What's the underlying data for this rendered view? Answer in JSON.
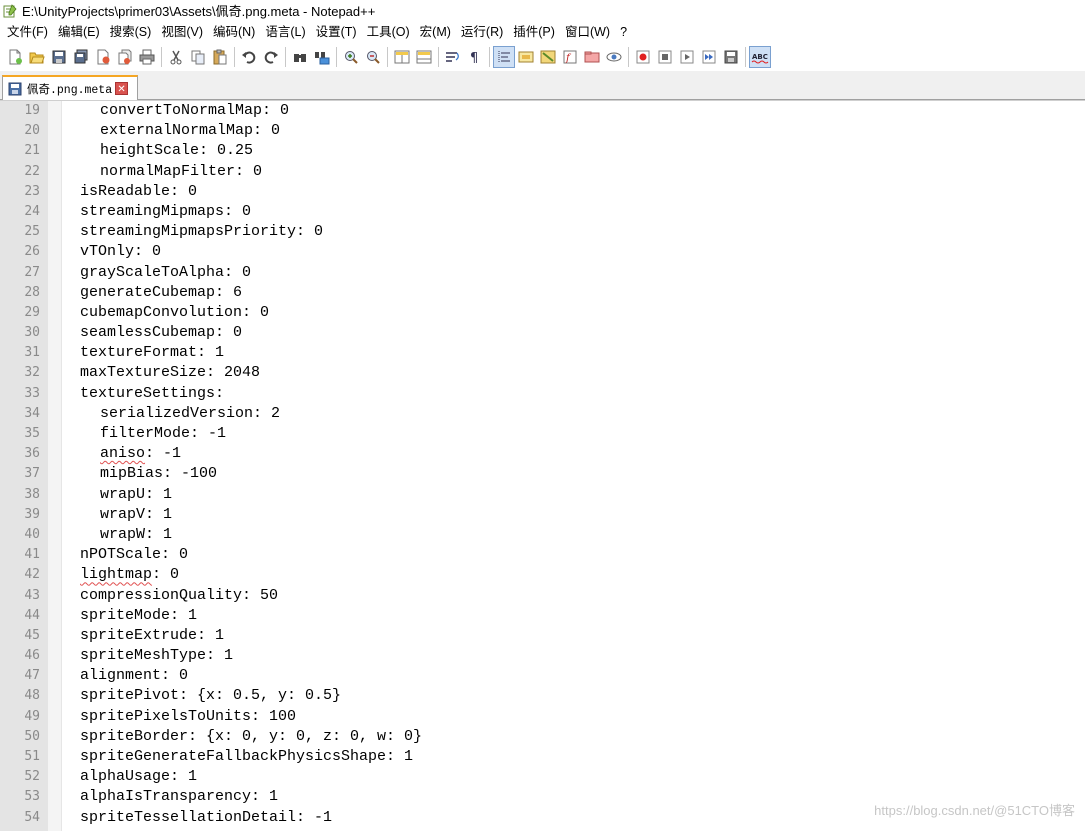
{
  "window": {
    "title": "E:\\UnityProjects\\primer03\\Assets\\佩奇.png.meta - Notepad++"
  },
  "menu": [
    "文件(F)",
    "编辑(E)",
    "搜索(S)",
    "视图(V)",
    "编码(N)",
    "语言(L)",
    "设置(T)",
    "工具(O)",
    "宏(M)",
    "运行(R)",
    "插件(P)",
    "窗口(W)",
    "?"
  ],
  "tab": {
    "label": "佩奇.png.meta",
    "close_glyph": "✕"
  },
  "editor": {
    "lines": [
      {
        "n": "19",
        "indent": 2,
        "text": "convertToNormalMap: 0"
      },
      {
        "n": "20",
        "indent": 2,
        "text": "externalNormalMap: 0"
      },
      {
        "n": "21",
        "indent": 2,
        "text": "heightScale: 0.25"
      },
      {
        "n": "22",
        "indent": 2,
        "text": "normalMapFilter: 0"
      },
      {
        "n": "23",
        "indent": 1,
        "text": "isReadable: 0"
      },
      {
        "n": "24",
        "indent": 1,
        "text": "streamingMipmaps: 0"
      },
      {
        "n": "25",
        "indent": 1,
        "text": "streamingMipmapsPriority: 0"
      },
      {
        "n": "26",
        "indent": 1,
        "text": "vTOnly: 0"
      },
      {
        "n": "27",
        "indent": 1,
        "text": "grayScaleToAlpha: 0"
      },
      {
        "n": "28",
        "indent": 1,
        "text": "generateCubemap: 6"
      },
      {
        "n": "29",
        "indent": 1,
        "text": "cubemapConvolution: 0"
      },
      {
        "n": "30",
        "indent": 1,
        "text": "seamlessCubemap: 0"
      },
      {
        "n": "31",
        "indent": 1,
        "text": "textureFormat: 1"
      },
      {
        "n": "32",
        "indent": 1,
        "text": "maxTextureSize: 2048"
      },
      {
        "n": "33",
        "indent": 1,
        "text": "textureSettings:"
      },
      {
        "n": "34",
        "indent": 2,
        "text": "serializedVersion: 2"
      },
      {
        "n": "35",
        "indent": 2,
        "text": "filterMode: -1"
      },
      {
        "n": "36",
        "indent": 2,
        "text": "aniso: -1",
        "squiggle": "aniso"
      },
      {
        "n": "37",
        "indent": 2,
        "text": "mipBias: -100"
      },
      {
        "n": "38",
        "indent": 2,
        "text": "wrapU: 1"
      },
      {
        "n": "39",
        "indent": 2,
        "text": "wrapV: 1"
      },
      {
        "n": "40",
        "indent": 2,
        "text": "wrapW: 1"
      },
      {
        "n": "41",
        "indent": 1,
        "text": "nPOTScale: 0"
      },
      {
        "n": "42",
        "indent": 1,
        "text": "lightmap: 0",
        "squiggle": "lightmap"
      },
      {
        "n": "43",
        "indent": 1,
        "text": "compressionQuality: 50"
      },
      {
        "n": "44",
        "indent": 1,
        "text": "spriteMode: 1"
      },
      {
        "n": "45",
        "indent": 1,
        "text": "spriteExtrude: 1"
      },
      {
        "n": "46",
        "indent": 1,
        "text": "spriteMeshType: 1"
      },
      {
        "n": "47",
        "indent": 1,
        "text": "alignment: 0"
      },
      {
        "n": "48",
        "indent": 1,
        "text": "spritePivot: {x: 0.5, y: 0.5}"
      },
      {
        "n": "49",
        "indent": 1,
        "text": "spritePixelsToUnits: 100"
      },
      {
        "n": "50",
        "indent": 1,
        "text": "spriteBorder: {x: 0, y: 0, z: 0, w: 0}"
      },
      {
        "n": "51",
        "indent": 1,
        "text": "spriteGenerateFallbackPhysicsShape: 1"
      },
      {
        "n": "52",
        "indent": 1,
        "text": "alphaUsage: 1"
      },
      {
        "n": "53",
        "indent": 1,
        "text": "alphaIsTransparency: 1"
      },
      {
        "n": "54",
        "indent": 1,
        "text": "spriteTessellationDetail: -1"
      }
    ]
  },
  "watermark": "https://blog.csdn.net/@51CTO博客",
  "colors": {
    "tab_accent": "#f5a623",
    "gutter_bg": "#e4e4e4",
    "line_number": "#8a8a8a",
    "record_red": "#e02020",
    "spell_squiggle": "#e05050"
  },
  "toolbar": {
    "groups": [
      [
        "new-file-icon",
        "open-file-icon",
        "save-icon",
        "save-all-icon",
        "close-icon",
        "close-all-icon",
        "print-icon"
      ],
      [
        "cut-icon",
        "copy-icon",
        "paste-icon"
      ],
      [
        "undo-icon",
        "redo-icon"
      ],
      [
        "find-icon",
        "replace-icon"
      ],
      [
        "zoom-in-icon",
        "zoom-out-icon"
      ],
      [
        "sync-vertical-icon",
        "sync-horizontal-icon"
      ],
      [
        "word-wrap-icon",
        "show-all-chars-icon"
      ],
      [
        "indent-guide-icon",
        "udl-icon",
        "doc-map-icon",
        "function-list-icon",
        "folder-workspace-icon",
        "monitor-icon"
      ],
      [
        "record-macro-icon",
        "stop-record-icon",
        "play-macro-icon",
        "run-macro-multiple-icon",
        "save-macro-icon"
      ],
      [
        "spell-check-icon"
      ]
    ]
  }
}
